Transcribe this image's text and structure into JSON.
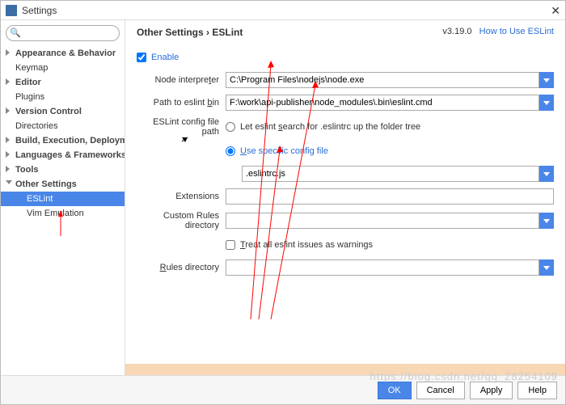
{
  "window": {
    "title": "Settings"
  },
  "sidebar": {
    "search_placeholder": "",
    "items": [
      {
        "label": "Appearance & Behavior",
        "type": "cat",
        "arrow": "right"
      },
      {
        "label": "Keymap",
        "type": "item"
      },
      {
        "label": "Editor",
        "type": "cat",
        "arrow": "right"
      },
      {
        "label": "Plugins",
        "type": "item"
      },
      {
        "label": "Version Control",
        "type": "cat",
        "arrow": "right"
      },
      {
        "label": "Directories",
        "type": "item"
      },
      {
        "label": "Build, Execution, Deployment",
        "type": "cat",
        "arrow": "right"
      },
      {
        "label": "Languages & Frameworks",
        "type": "cat",
        "arrow": "right"
      },
      {
        "label": "Tools",
        "type": "cat",
        "arrow": "right"
      },
      {
        "label": "Other Settings",
        "type": "cat",
        "arrow": "down"
      },
      {
        "label": "ESLint",
        "type": "sub",
        "selected": true
      },
      {
        "label": "Vim Emulation",
        "type": "sub"
      }
    ]
  },
  "breadcrumb": {
    "parent": "Other Settings",
    "sep": "›",
    "current": "ESLint"
  },
  "version": "v3.19.0",
  "help_link": "How to Use ESLint",
  "form": {
    "enable_label": "Enable",
    "enable_checked": true,
    "node_interpreter": {
      "label": "Node interpreter",
      "value": "C:\\Program Files\\nodejs\\node.exe"
    },
    "eslint_bin": {
      "label": "Path to eslint bin",
      "value": "F:\\work\\api-publisher\\node_modules\\.bin\\eslint.cmd"
    },
    "config_path_label": "ESLint config file path",
    "radio_search_label": "Let eslint search for .eslintrc up the folder tree",
    "radio_specific_label": "Use specific config file",
    "config_file_value": ".eslintrc.js",
    "extensions": {
      "label": "Extensions",
      "value": ""
    },
    "custom_rules": {
      "label": "Custom Rules directory",
      "value": ""
    },
    "treat_warnings_label": "Treat all eslint issues as warnings",
    "rules_dir": {
      "label": "Rules directory",
      "value": ""
    }
  },
  "footer": {
    "ok": "OK",
    "cancel": "Cancel",
    "apply": "Apply",
    "help": "Help"
  },
  "watermark": "https://blog.csdn.net/qq_28254109"
}
